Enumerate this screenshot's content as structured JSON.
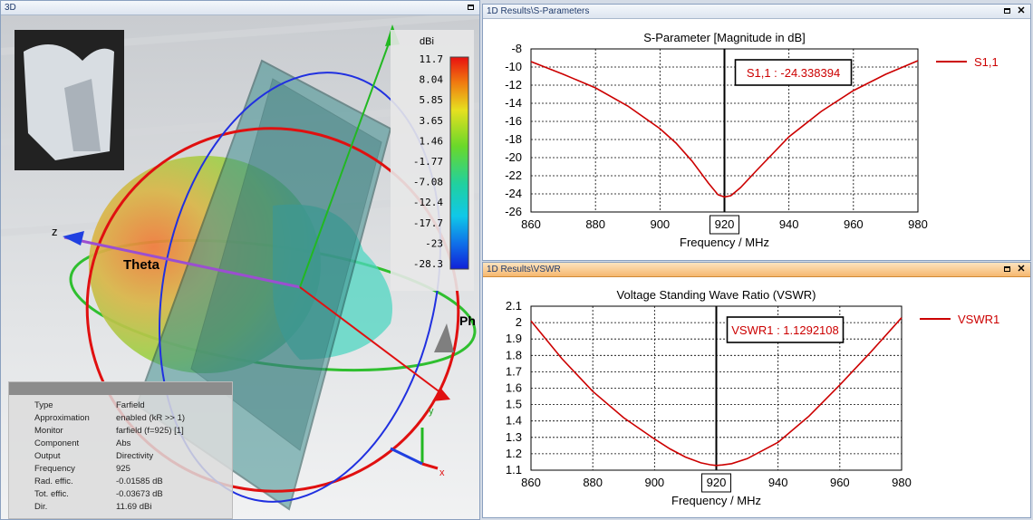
{
  "panels": {
    "view3d": {
      "title": "3D"
    },
    "sparam": {
      "title": "1D Results\\S-Parameters"
    },
    "vswr": {
      "title": "1D Results\\VSWR"
    }
  },
  "view3d": {
    "colorbar_unit": "dBi",
    "colorbar_labels": [
      "11.7",
      "8.04",
      "5.85",
      "3.65",
      "1.46",
      "-1.77",
      "-7.08",
      "-12.4",
      "-17.7",
      "-23",
      "-28.3"
    ],
    "axis_labels": {
      "z": "z",
      "theta": "Theta",
      "phi": "Ph",
      "y": "y",
      "x": "x"
    },
    "info": [
      {
        "label": "Type",
        "value": "Farfield"
      },
      {
        "label": "Approximation",
        "value": "enabled (kR >> 1)"
      },
      {
        "label": "Monitor",
        "value": "farfield (f=925) [1]"
      },
      {
        "label": "Component",
        "value": "Abs"
      },
      {
        "label": "Output",
        "value": "Directivity"
      },
      {
        "label": "Frequency",
        "value": "925"
      },
      {
        "label": "Rad. effic.",
        "value": "-0.01585 dB"
      },
      {
        "label": "Tot. effic.",
        "value": "-0.03673 dB"
      },
      {
        "label": "Dir.",
        "value": "11.69 dBi"
      }
    ]
  },
  "chart_data": [
    {
      "type": "line",
      "title": "S-Parameter [Magnitude in dB]",
      "xlabel": "Frequency / MHz",
      "ylabel": "",
      "xlim": [
        860,
        980
      ],
      "ylim": [
        -26,
        -8
      ],
      "xticks": [
        860,
        880,
        900,
        920,
        940,
        960,
        980
      ],
      "yticks": [
        -8,
        -10,
        -12,
        -14,
        -16,
        -18,
        -20,
        -22,
        -24,
        -26
      ],
      "grid": true,
      "legend": "right",
      "marker_x": 920,
      "marker_label": "S1,1 : -24.338394",
      "series": [
        {
          "name": "S1,1",
          "color": "#cc0000",
          "x": [
            860,
            870,
            880,
            890,
            900,
            905,
            910,
            915,
            918,
            920,
            922,
            925,
            930,
            940,
            950,
            960,
            970,
            980
          ],
          "y": [
            -9.4,
            -10.8,
            -12.3,
            -14.3,
            -16.8,
            -18.4,
            -20.4,
            -22.8,
            -24.1,
            -24.34,
            -24.2,
            -23.3,
            -21.4,
            -17.7,
            -14.9,
            -12.6,
            -10.8,
            -9.3
          ]
        }
      ]
    },
    {
      "type": "line",
      "title": "Voltage Standing Wave Ratio (VSWR)",
      "xlabel": "Frequency / MHz",
      "ylabel": "",
      "xlim": [
        860,
        980
      ],
      "ylim": [
        1.1,
        2.1
      ],
      "xticks": [
        860,
        880,
        900,
        920,
        940,
        960,
        980
      ],
      "yticks": [
        2.1,
        2,
        1.9,
        1.8,
        1.7,
        1.6,
        1.5,
        1.4,
        1.3,
        1.2,
        1.1
      ],
      "grid": true,
      "legend": "right",
      "marker_x": 920,
      "marker_label": "VSWR1 : 1.1292108",
      "series": [
        {
          "name": "VSWR1",
          "color": "#cc0000",
          "x": [
            860,
            870,
            880,
            890,
            900,
            905,
            910,
            915,
            918,
            920,
            922,
            925,
            930,
            940,
            950,
            960,
            970,
            980
          ],
          "y": [
            2.01,
            1.78,
            1.58,
            1.42,
            1.29,
            1.23,
            1.18,
            1.145,
            1.133,
            1.129,
            1.132,
            1.14,
            1.17,
            1.27,
            1.43,
            1.62,
            1.82,
            2.03
          ]
        }
      ]
    }
  ]
}
